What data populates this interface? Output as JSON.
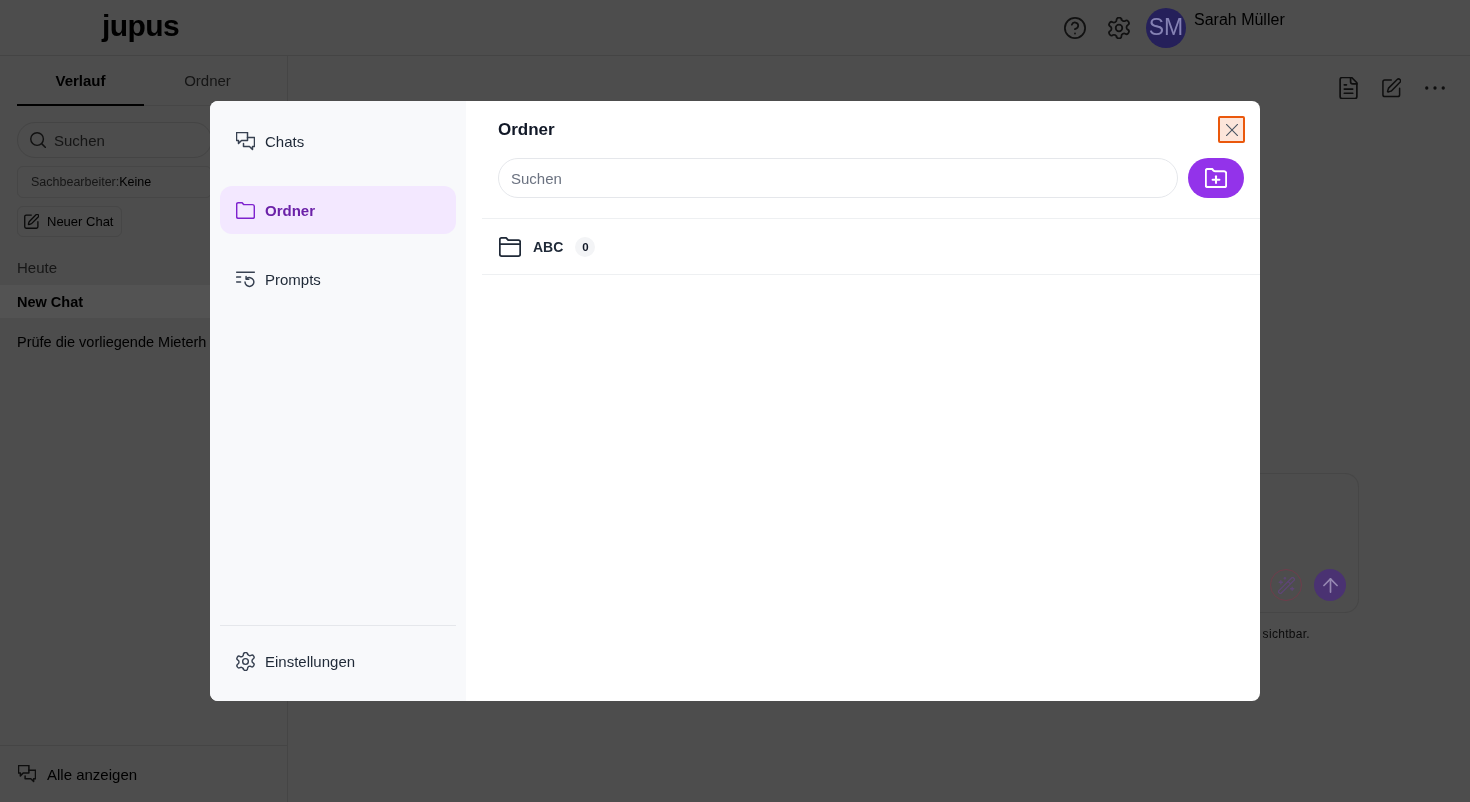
{
  "header": {
    "logo": "jupus",
    "user": {
      "initials": "SM",
      "name": "Sarah Müller"
    }
  },
  "sidebar": {
    "tabs": [
      {
        "label": "Verlauf",
        "selected": true
      },
      {
        "label": "Ordner",
        "selected": false
      }
    ],
    "search": {
      "placeholder": "Suchen"
    },
    "filter": {
      "label": "Sachbearbeiter:",
      "value": "Keine"
    },
    "new_chat_button": {
      "label": "Neuer Chat"
    },
    "groups": [
      {
        "heading": "Heute",
        "items": [
          {
            "title": "New Chat",
            "selected": true
          },
          {
            "title": "Prüfe die vorliegende Mieterh",
            "selected": false
          }
        ]
      }
    ],
    "show_all_link": {
      "label": "Alle anzeigen"
    }
  },
  "composer": {
    "note": "sichtbar."
  },
  "dialog": {
    "nav": [
      {
        "label": "Chats",
        "selected": false
      },
      {
        "label": "Ordner",
        "selected": true
      },
      {
        "label": "Prompts",
        "selected": false
      }
    ],
    "settings_item": {
      "label": "Einstellungen"
    },
    "title": "Ordner",
    "close_button": {
      "focused": true
    },
    "search": {
      "placeholder": "Suchen"
    },
    "folders": [
      {
        "name": "ABC",
        "count": "0"
      }
    ]
  }
}
